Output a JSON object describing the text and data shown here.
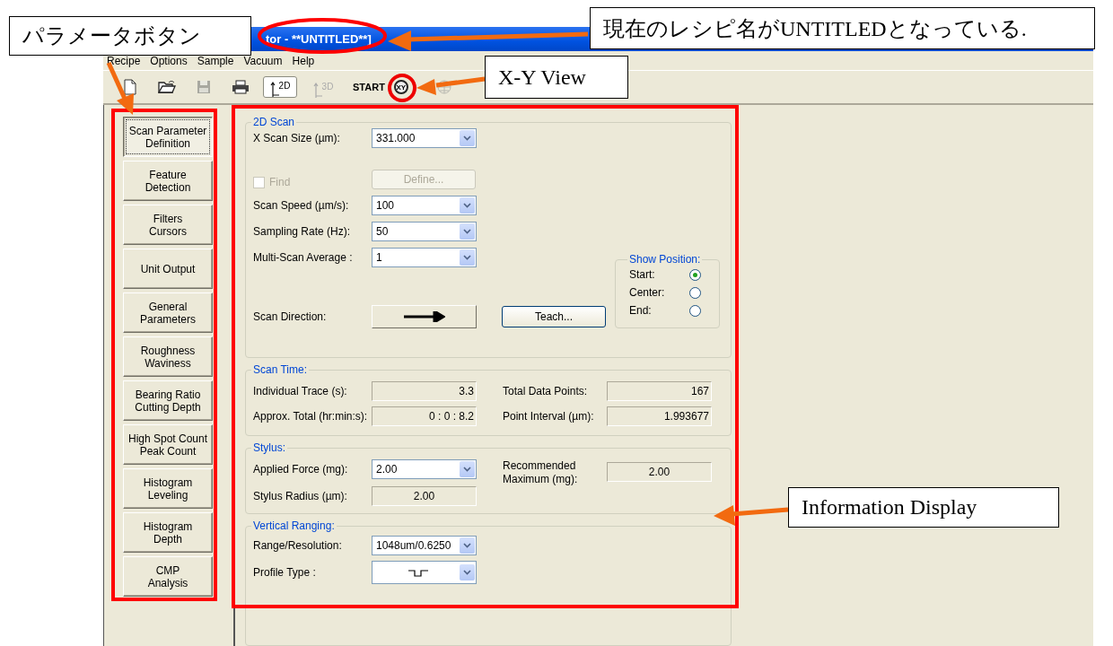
{
  "window": {
    "title": "tor - **UNTITLED**]"
  },
  "menu": [
    "Recipe",
    "Options",
    "Sample",
    "Vacuum",
    "Help"
  ],
  "toolbar": [
    {
      "kind": "new",
      "disabled": false
    },
    {
      "kind": "open",
      "disabled": false
    },
    {
      "kind": "save",
      "disabled": true
    },
    {
      "kind": "print",
      "disabled": false
    },
    {
      "kind": "view",
      "label": "2D",
      "selected": true,
      "disabled": false
    },
    {
      "kind": "view",
      "label": "3D",
      "selected": false,
      "disabled": true
    },
    {
      "kind": "start",
      "label": "START",
      "disabled": false
    },
    {
      "kind": "xy",
      "label": "XY",
      "disabled": false
    },
    {
      "kind": "grid",
      "disabled": true
    }
  ],
  "sidebar": {
    "buttons": [
      {
        "label": "Scan Parameter\nDefinition",
        "selected": true
      },
      {
        "label": "Feature\nDetection",
        "selected": false
      },
      {
        "label": "Filters\nCursors",
        "selected": false
      },
      {
        "label": "Unit Output",
        "selected": false
      },
      {
        "label": "General\nParameters",
        "selected": false
      },
      {
        "label": "Roughness\nWaviness",
        "selected": false
      },
      {
        "label": "Bearing Ratio\nCutting Depth",
        "selected": false
      },
      {
        "label": "High Spot Count\nPeak Count",
        "selected": false
      },
      {
        "label": "Histogram\nLeveling",
        "selected": false
      },
      {
        "label": "Histogram\nDepth",
        "selected": false
      },
      {
        "label": "CMP\nAnalysis",
        "selected": false
      }
    ]
  },
  "scan_2d": {
    "title": "2D Scan",
    "x_scan_size": {
      "label": "X Scan Size (µm):",
      "value": "331.000"
    },
    "find": {
      "label": "Find",
      "checked": false,
      "disabled": true
    },
    "define": {
      "label": "Define...",
      "disabled": true
    },
    "scan_speed": {
      "label": "Scan Speed (µm/s):",
      "value": "100"
    },
    "sampling_rate": {
      "label": "Sampling Rate (Hz):",
      "value": "50"
    },
    "multi_scan": {
      "label": "Multi-Scan Average :",
      "value": "1"
    },
    "scan_direction": {
      "label": "Scan Direction:"
    },
    "teach": {
      "label": "Teach..."
    },
    "show_position": {
      "title": "Show Position:",
      "options": [
        {
          "label": "Start:",
          "selected": true
        },
        {
          "label": "Center:",
          "selected": false
        },
        {
          "label": "End:",
          "selected": false
        }
      ]
    }
  },
  "scan_time": {
    "title": "Scan Time:",
    "fields": [
      {
        "label": "Individual Trace (s):",
        "value": "3.3"
      },
      {
        "label": "Total Data Points:",
        "value": "167"
      },
      {
        "label": "Approx. Total (hr:min:s):",
        "value": "0 : 0 : 8.2"
      },
      {
        "label": "Point Interval (µm):",
        "value": "1.993677"
      }
    ]
  },
  "stylus": {
    "title": "Stylus:",
    "applied_force": {
      "label": "Applied Force (mg):",
      "value": "2.00"
    },
    "recommended": {
      "label": "Recommended\nMaximum (mg):",
      "value": "2.00"
    },
    "stylus_radius": {
      "label": "Stylus Radius (µm):",
      "value": "2.00"
    }
  },
  "vertical_ranging": {
    "title": "Vertical Ranging:",
    "range": {
      "label": "Range/Resolution:",
      "value": "1048um/0.6250"
    },
    "profile_type": {
      "label": "Profile Type :"
    }
  },
  "callouts": [
    {
      "text": "パラメータボタン"
    },
    {
      "text": "現在のレシピ名がUNTITLEDとなっている."
    },
    {
      "text": "X-Y View"
    },
    {
      "text": "Information Display"
    }
  ]
}
